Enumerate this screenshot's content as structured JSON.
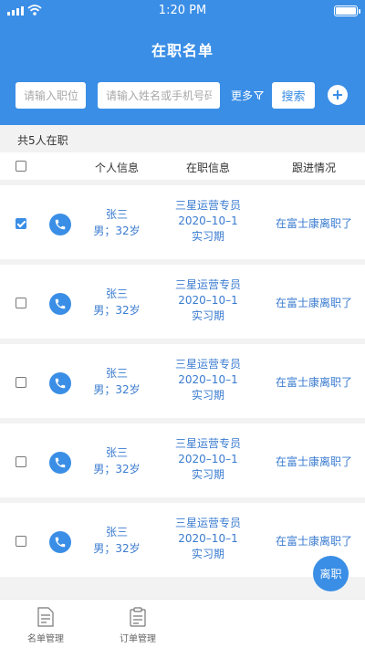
{
  "status_bar": {
    "time": "1:20 PM"
  },
  "header": {
    "title": "在职名单",
    "position_placeholder": "请输入职位",
    "name_placeholder": "请输入姓名或手机号码",
    "more_label": "更多",
    "search_label": "搜索"
  },
  "summary": "共5人在职",
  "table": {
    "columns": [
      "个人信息",
      "在职信息",
      "跟进情况"
    ],
    "rows": [
      {
        "checked": true,
        "name": "张三",
        "detail": "男；32岁",
        "job": "三星运营专员",
        "date": "2020–10–1",
        "stage": "实习期",
        "follow": "在富士康离职了"
      },
      {
        "checked": false,
        "name": "张三",
        "detail": "男；32岁",
        "job": "三星运营专员",
        "date": "2020–10–1",
        "stage": "实习期",
        "follow": "在富士康离职了"
      },
      {
        "checked": false,
        "name": "张三",
        "detail": "男；32岁",
        "job": "三星运营专员",
        "date": "2020–10–1",
        "stage": "实习期",
        "follow": "在富士康离职了"
      },
      {
        "checked": false,
        "name": "张三",
        "detail": "男；32岁",
        "job": "三星运营专员",
        "date": "2020–10–1",
        "stage": "实习期",
        "follow": "在富士康离职了"
      },
      {
        "checked": false,
        "name": "张三",
        "detail": "男；32岁",
        "job": "三星运营专员",
        "date": "2020–10–1",
        "stage": "实习期",
        "follow": "在富士康离职了"
      }
    ]
  },
  "resign_button": "离职",
  "tabbar": {
    "list_label": "名单管理",
    "orders_label": "订单管理"
  },
  "colors": {
    "primary": "#3a8ee6",
    "text_link": "#3a7bd0",
    "background": "#f2f2f2"
  },
  "icons": [
    "signal-icon",
    "wifi-icon",
    "battery-icon",
    "filter-icon",
    "plus-icon",
    "phone-icon",
    "list-doc-icon",
    "clipboard-icon"
  ]
}
